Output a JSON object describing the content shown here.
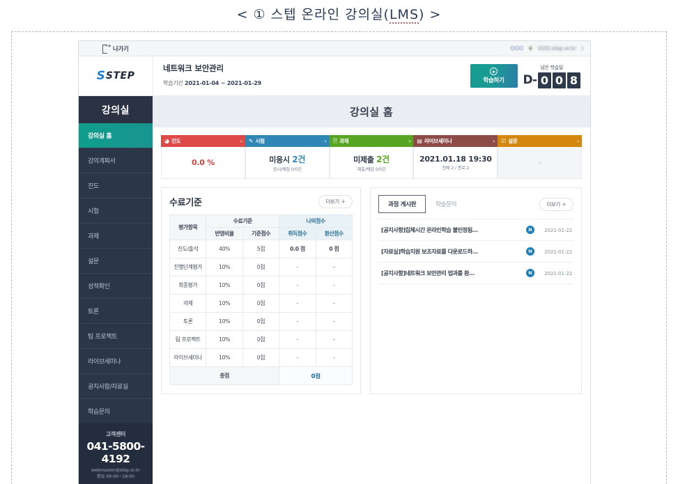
{
  "caption": {
    "prefix": "< ① 스텝 온라인 강의실(",
    "underlined": "LMS",
    "suffix": ") >"
  },
  "topbar": {
    "exit_label": "나가기",
    "exit_icon": "exit-door-icon",
    "user_masked": "OOO",
    "leaf_icon": "leaf-icon",
    "email_masked": "OOO.step.or.kr",
    "trailing": ")"
  },
  "header": {
    "logo_s": "S",
    "logo_text": "STEP",
    "course_title": "네트워크 보안관리",
    "period_label": "학습기간",
    "period_value": "2021-01-04 ~ 2021-01-29",
    "study_button": "학습하기",
    "play_icon": "play-circle-icon",
    "dday_label": "남은 학습일",
    "dday_prefix": "D-",
    "dday_digits": [
      "0",
      "0",
      "8"
    ]
  },
  "sidebar": {
    "title": "강의실",
    "items": [
      {
        "label": "강의실 홈",
        "active": true
      },
      {
        "label": "강의계획서",
        "active": false
      },
      {
        "label": "진도",
        "active": false
      },
      {
        "label": "시험",
        "active": false
      },
      {
        "label": "과제",
        "active": false
      },
      {
        "label": "설문",
        "active": false
      },
      {
        "label": "성적확인",
        "active": false
      },
      {
        "label": "토론",
        "active": false
      },
      {
        "label": "팀 프로젝트",
        "active": false
      },
      {
        "label": "라이브세미나",
        "active": false
      },
      {
        "label": "공지사항/자료실",
        "active": false
      },
      {
        "label": "학습문의",
        "active": false
      }
    ],
    "footer": {
      "cs_label": "고객센터",
      "phone": "041-5800-4192",
      "email": "webmaster@step.or.kr",
      "hours": "평일 09:00~18:00"
    }
  },
  "main": {
    "page_title": "강의실 홈",
    "cards": [
      {
        "label": "진도",
        "icon": "pie-chart-icon",
        "color": "#dd4a47",
        "main": "0.0 %",
        "main_accent": "",
        "sub": "",
        "empty": false
      },
      {
        "label": "시험",
        "icon": "pencil-icon",
        "color": "#2e87b5",
        "main": "미응시 ",
        "main_accent": "2건",
        "sub": "응시/채점 0/0건",
        "empty": false
      },
      {
        "label": "과제",
        "icon": "document-icon",
        "color": "#57a520",
        "main": "미제출 ",
        "main_accent": "2건",
        "sub": "제출/채점 0/0건",
        "empty": false
      },
      {
        "label": "라이브세미나",
        "icon": "video-camera-icon",
        "color": "#8c4b46",
        "main": "2021.01.18 19:30",
        "main_accent": "",
        "sub": "전체 2 / 종료 2",
        "empty": false
      },
      {
        "label": "설문",
        "icon": "clipboard-check-icon",
        "color": "#d4870f",
        "main": "-",
        "main_accent": "",
        "sub": "",
        "empty": true
      }
    ],
    "criteria_panel": {
      "title": "수료기준",
      "more_label": "더보기 ＋",
      "headers": {
        "item": "평가항목",
        "group_standard": "수료기준",
        "group_mine": "나의점수",
        "ratio": "반영비율",
        "base_score": "기준점수",
        "earned": "취득점수",
        "converted": "환산점수"
      },
      "rows": [
        {
          "name": "진도/출석",
          "ratio": "40%",
          "base": "5점",
          "earned": "0.0 점",
          "converted": "0 점",
          "has_score": true
        },
        {
          "name": "진행단계평가",
          "ratio": "10%",
          "base": "0점",
          "earned": "-",
          "converted": "-",
          "has_score": false
        },
        {
          "name": "최종평가",
          "ratio": "10%",
          "base": "0점",
          "earned": "-",
          "converted": "-",
          "has_score": false
        },
        {
          "name": "과제",
          "ratio": "10%",
          "base": "0점",
          "earned": "-",
          "converted": "-",
          "has_score": false
        },
        {
          "name": "토론",
          "ratio": "10%",
          "base": "0점",
          "earned": "-",
          "converted": "-",
          "has_score": false
        },
        {
          "name": "팀 프로젝트",
          "ratio": "10%",
          "base": "0점",
          "earned": "-",
          "converted": "-",
          "has_score": false
        },
        {
          "name": "라이브세미나",
          "ratio": "10%",
          "base": "0점",
          "earned": "-",
          "converted": "-",
          "has_score": false
        }
      ],
      "total_label": "총점",
      "total_value": "0점"
    },
    "board_panel": {
      "tab_active": "과정 게시판",
      "tab_inactive": "학습문의",
      "more_label": "더보기 ＋",
      "badge_text": "N",
      "rows": [
        {
          "title": "[공지사항]집체시간 온라인학습 불인정됨…",
          "badge": "N",
          "date": "2021-01-22"
        },
        {
          "title": "[자료실]학습지원 보조자료를 다운로드하…",
          "badge": "N",
          "date": "2021-01-22"
        },
        {
          "title": "[공지사항]네트워크 보안관리 업과를 환…",
          "badge": "N",
          "date": "2021-01-22"
        }
      ]
    }
  },
  "colors": {
    "sidebar_bg": "#2b3648",
    "active_teal": "#0f9e8c",
    "accent_red": "#dd4a47",
    "accent_blue": "#2e87b5",
    "accent_green": "#57a520",
    "accent_brown": "#8c4b46",
    "accent_orange": "#d4870f"
  }
}
